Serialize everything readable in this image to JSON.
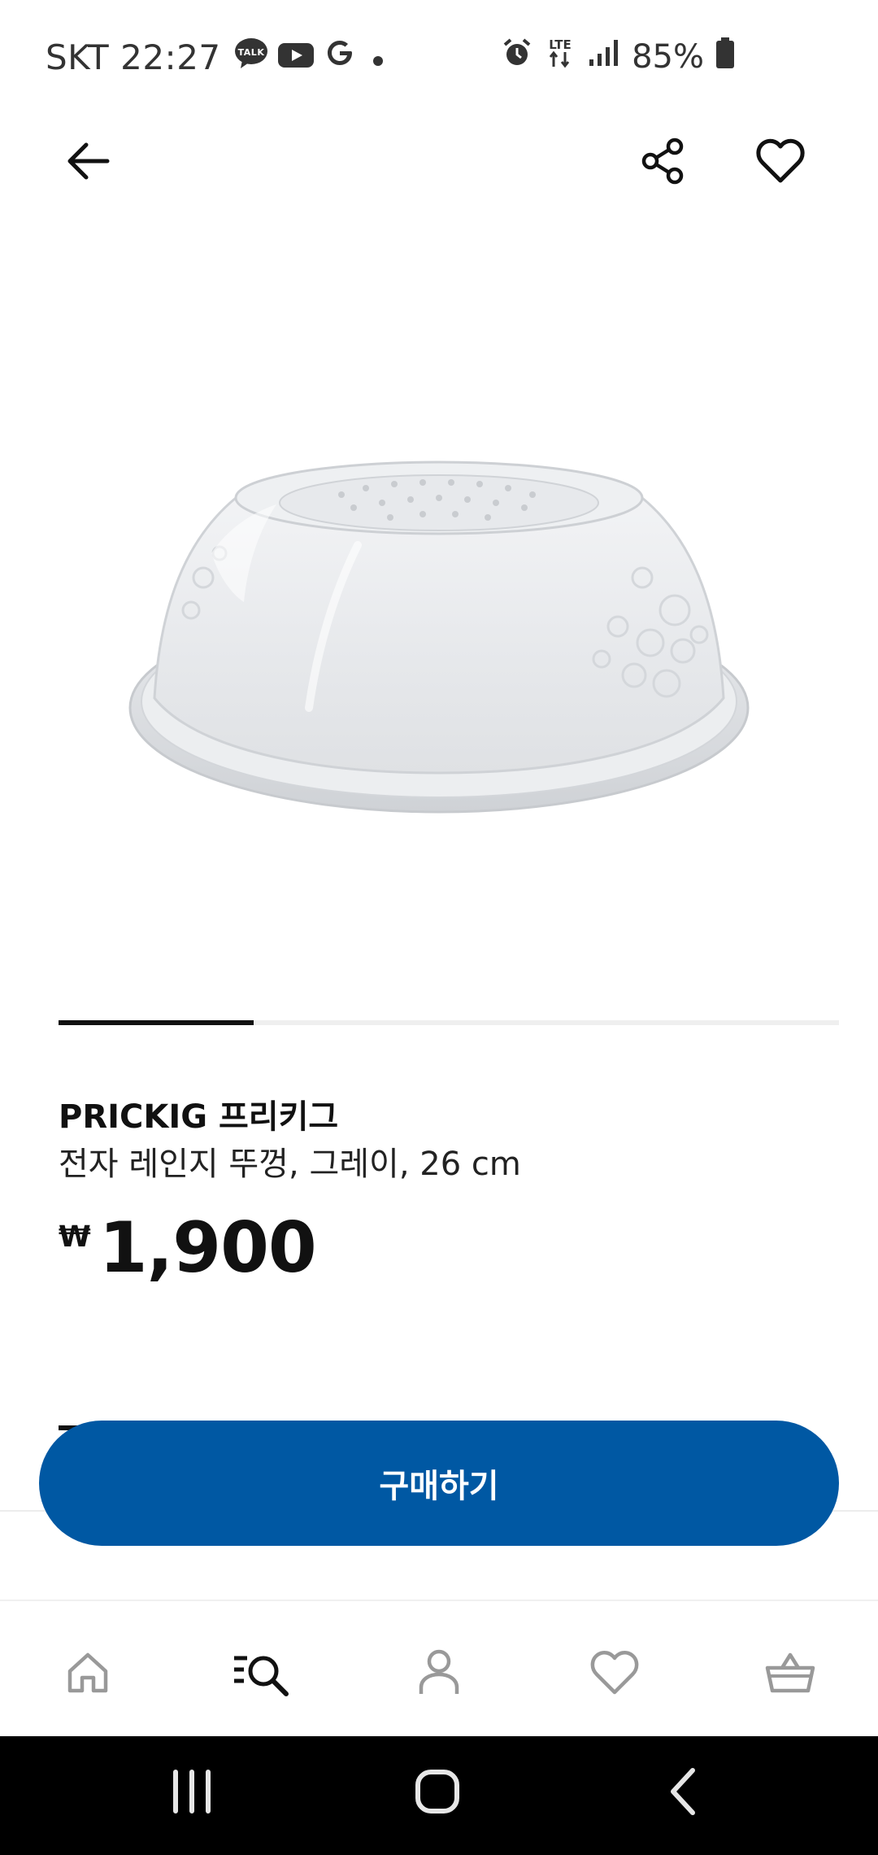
{
  "status_bar": {
    "carrier": "SKT",
    "time": "22:27",
    "notification_icons": [
      "talk-icon",
      "youtube-icon",
      "google-icon",
      "dot-icon"
    ],
    "talk_label": "TALK",
    "network": "LTE",
    "battery": "85%"
  },
  "top_nav": {
    "back_icon": "arrow-left-icon",
    "share_icon": "share-icon",
    "favorite_icon": "heart-icon"
  },
  "gallery": {
    "progress_fraction": 0.25
  },
  "product": {
    "name": "PRICKIG 프리키그",
    "description": "전자 레인지 뚜껑, 그레이, 26 cm",
    "currency": "₩",
    "price": "1,900"
  },
  "buy_button": {
    "label": "구매하기",
    "color": "#0058a3"
  },
  "tab_bar": {
    "items": [
      {
        "icon": "home-icon"
      },
      {
        "icon": "search-list-icon",
        "active": true
      },
      {
        "icon": "profile-icon"
      },
      {
        "icon": "heart-icon"
      },
      {
        "icon": "basket-icon"
      }
    ]
  },
  "system_nav": {
    "items": [
      "recents-icon",
      "home-icon",
      "back-icon"
    ]
  }
}
